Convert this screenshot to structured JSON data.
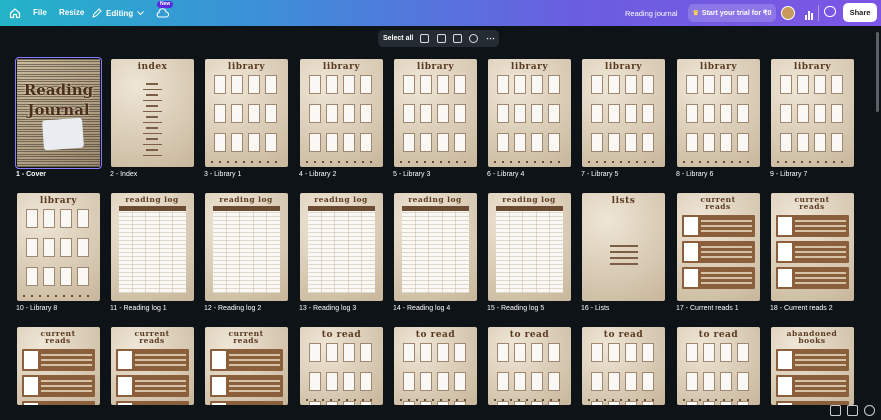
{
  "topbar": {
    "file": "File",
    "resize": "Resize",
    "editing": "Editing",
    "new_badge": "New",
    "doc_title": "Reading journal",
    "trial": "Start your trial for ₹0",
    "share": "Share"
  },
  "toolbar": {
    "select_all": "Select all"
  },
  "pages": [
    {
      "label": "1 - Cover",
      "kind": "cover",
      "title": "Reading Journal"
    },
    {
      "label": "2 - Index",
      "kind": "index",
      "title": "index"
    },
    {
      "label": "3 - Library 1",
      "kind": "library",
      "title": "library"
    },
    {
      "label": "4 - Library 2",
      "kind": "library",
      "title": "library"
    },
    {
      "label": "5 - Library 3",
      "kind": "library",
      "title": "library"
    },
    {
      "label": "6 - Library 4",
      "kind": "library",
      "title": "library"
    },
    {
      "label": "7 - Library 5",
      "kind": "library",
      "title": "library"
    },
    {
      "label": "8 - Library 6",
      "kind": "library",
      "title": "library"
    },
    {
      "label": "9 - Library 7",
      "kind": "library",
      "title": "library"
    },
    {
      "label": "10 - Library 8",
      "kind": "library",
      "title": "library"
    },
    {
      "label": "11 - Reading log 1",
      "kind": "log",
      "title": "reading log"
    },
    {
      "label": "12 - Reading log 2",
      "kind": "log",
      "title": "reading log"
    },
    {
      "label": "13 - Reading log 3",
      "kind": "log",
      "title": "reading log"
    },
    {
      "label": "14 - Reading log 4",
      "kind": "log",
      "title": "reading log"
    },
    {
      "label": "15 - Reading log 5",
      "kind": "log",
      "title": "reading log"
    },
    {
      "label": "16 - Lists",
      "kind": "lists",
      "title": "lists"
    },
    {
      "label": "17 - Current reads 1",
      "kind": "current",
      "title": "current reads"
    },
    {
      "label": "18 - Current reads 2",
      "kind": "current",
      "title": "current reads"
    },
    {
      "label": "",
      "kind": "current",
      "title": "current reads"
    },
    {
      "label": "",
      "kind": "current",
      "title": "current reads"
    },
    {
      "label": "",
      "kind": "current",
      "title": "current reads"
    },
    {
      "label": "",
      "kind": "library",
      "title": "to read"
    },
    {
      "label": "",
      "kind": "library",
      "title": "to read"
    },
    {
      "label": "",
      "kind": "library",
      "title": "to read"
    },
    {
      "label": "",
      "kind": "library",
      "title": "to read"
    },
    {
      "label": "",
      "kind": "library",
      "title": "to read"
    },
    {
      "label": "",
      "kind": "current",
      "title": "abandoned books"
    }
  ],
  "colors": {
    "canvas_bg": "#0e1318",
    "selection": "#8b7bff",
    "paper": "#ddd0bb",
    "ink": "#5a3a22"
  }
}
